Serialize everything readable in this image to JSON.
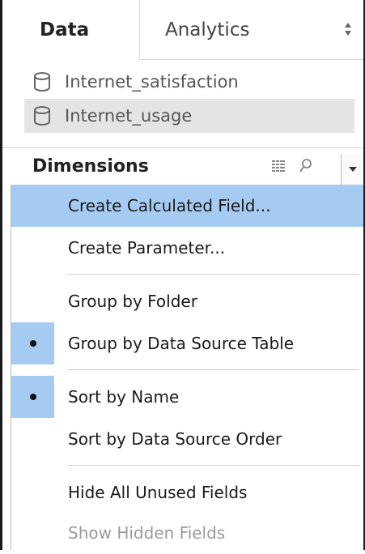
{
  "tabs": {
    "data_label": "Data",
    "analytics_label": "Analytics"
  },
  "data_sources": [
    {
      "label": "Internet_satisfaction",
      "icon": "database-icon",
      "selected": false
    },
    {
      "label": "Internet_usage",
      "icon": "database-icon",
      "selected": true
    }
  ],
  "dimensions": {
    "title": "Dimensions"
  },
  "menu": {
    "items": [
      {
        "label": "Create Calculated Field...",
        "highlighted": true
      },
      {
        "label": "Create Parameter..."
      },
      {
        "label": "Group by Folder"
      },
      {
        "label": "Group by Data Source Table",
        "checked": true
      },
      {
        "label": "Sort by Name",
        "checked": true
      },
      {
        "label": "Sort by Data Source Order"
      },
      {
        "label": "Hide All Unused Fields"
      },
      {
        "label": "Show Hidden Fields",
        "disabled": true
      }
    ]
  },
  "colors": {
    "highlight": "#a6cbf2",
    "selected_row": "#e4e4e4",
    "disabled_text": "#9a9a9a"
  }
}
